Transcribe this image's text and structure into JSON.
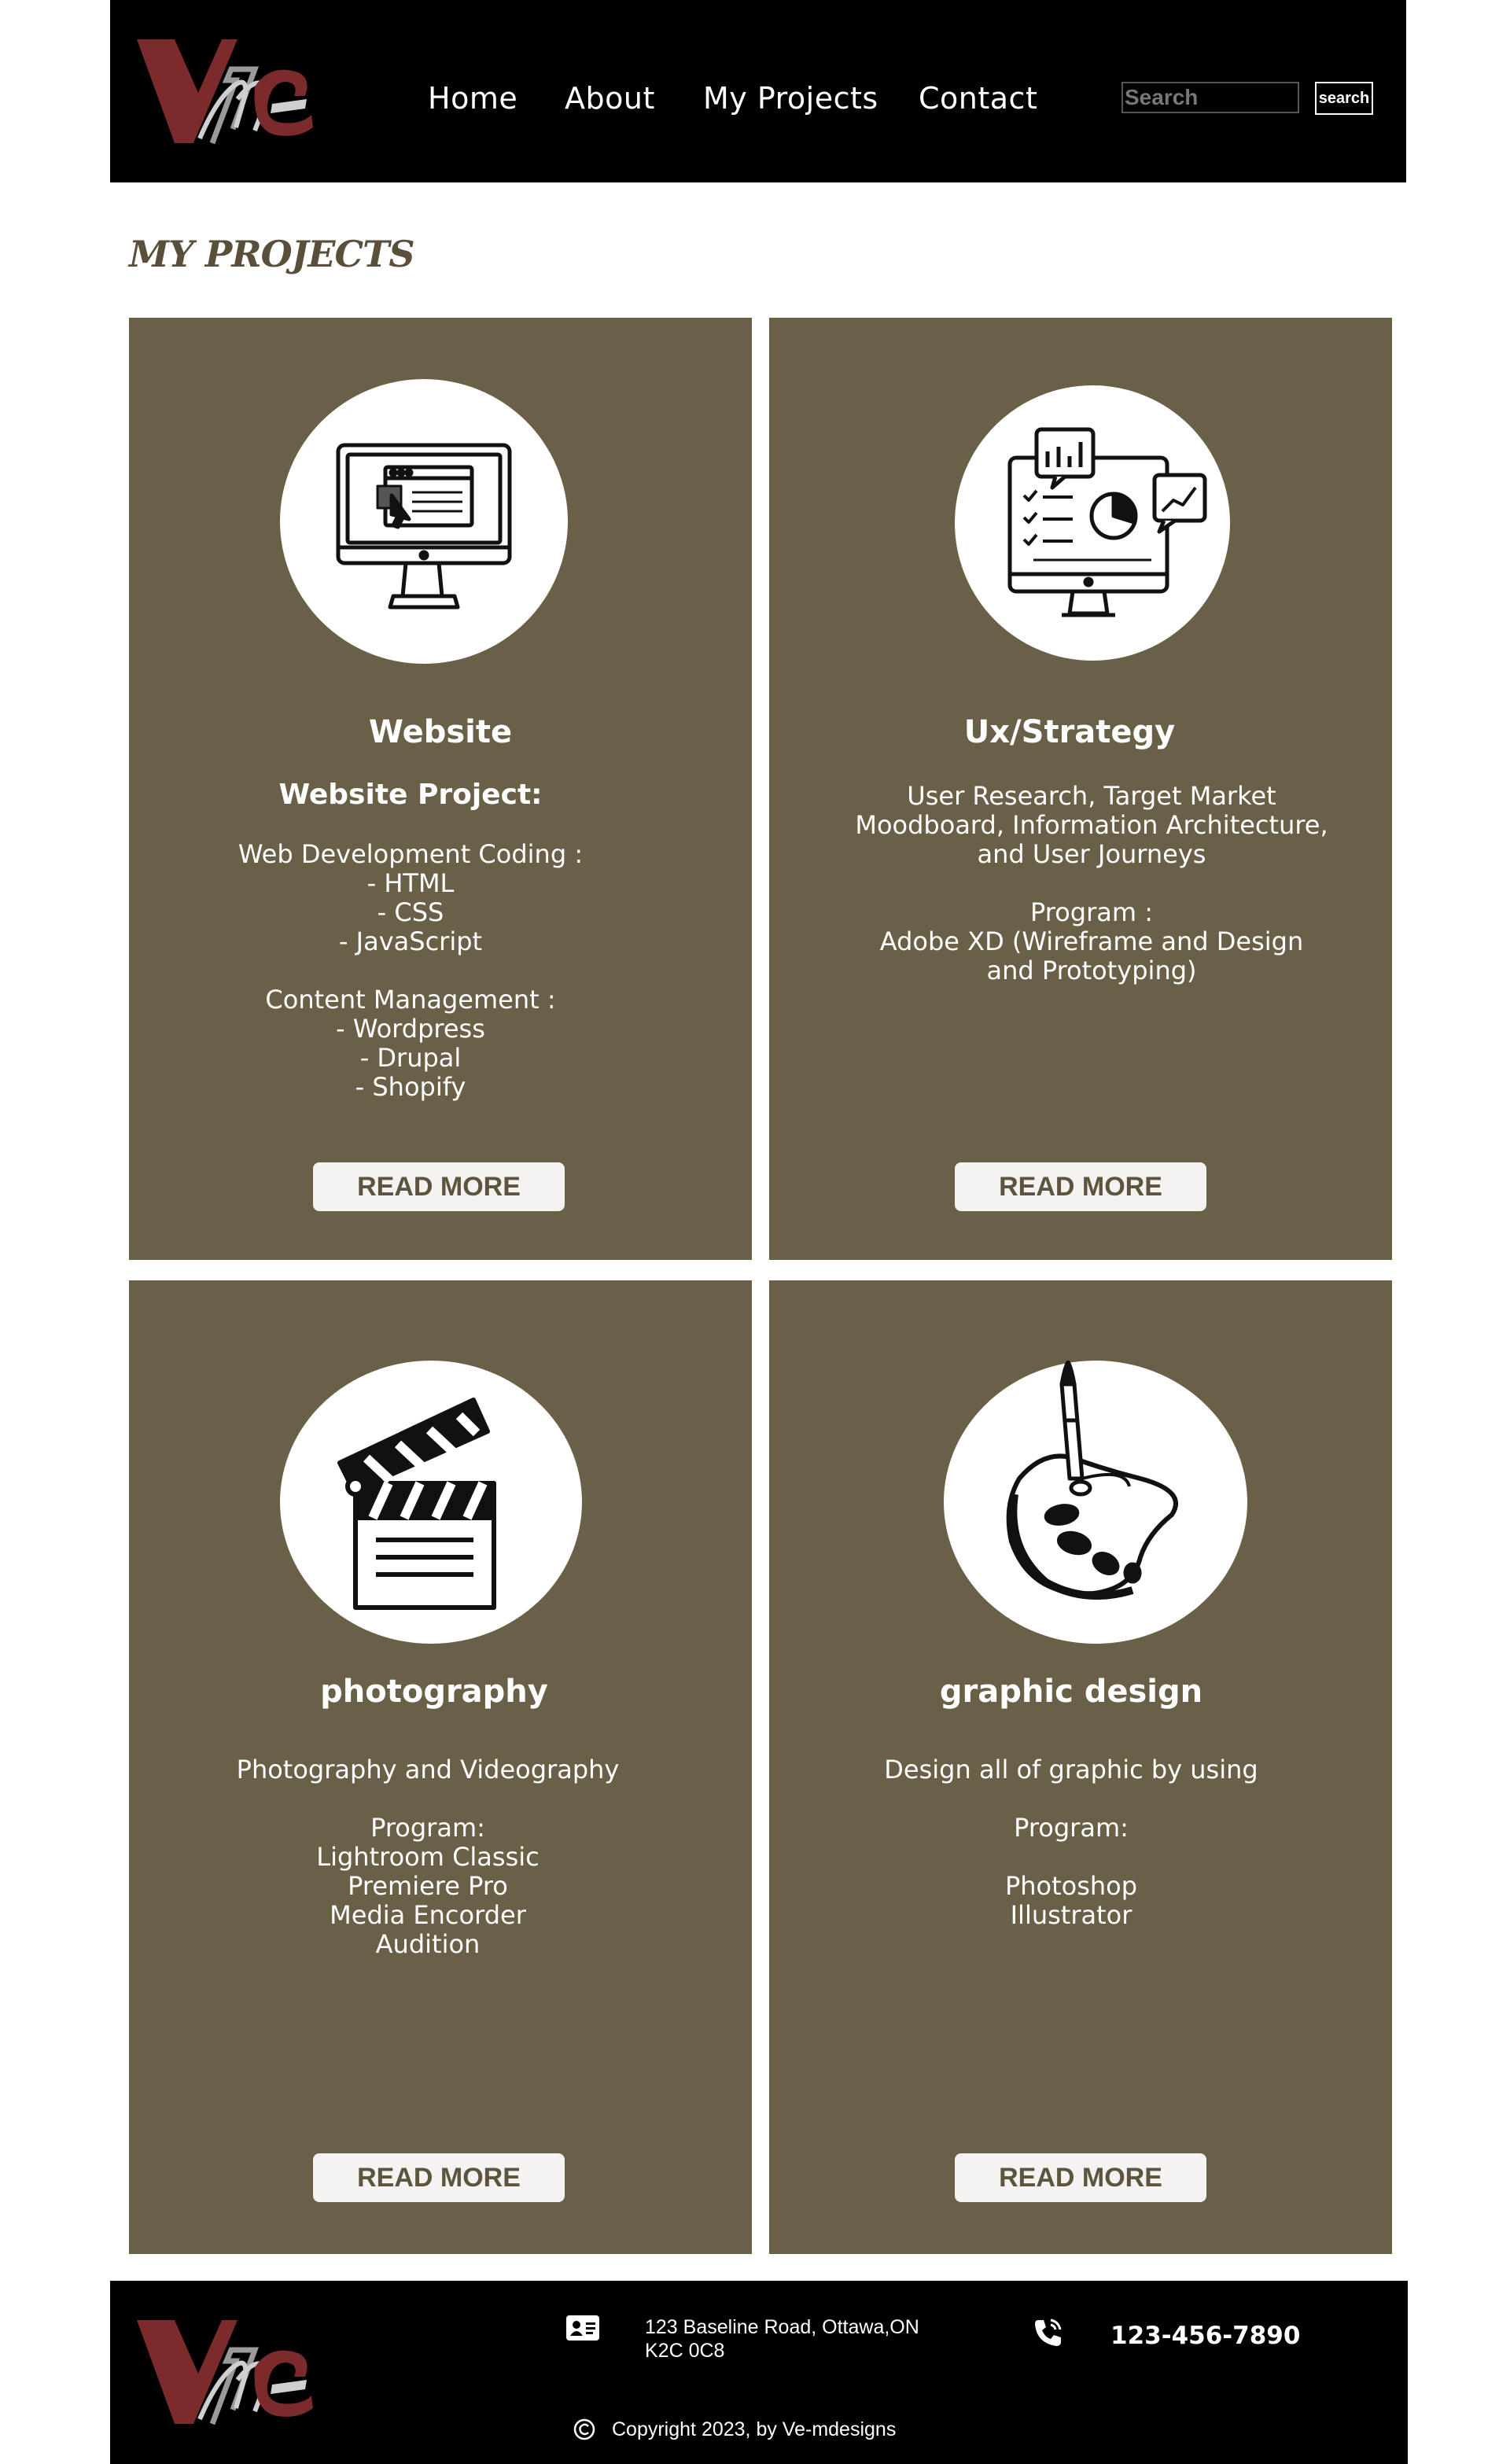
{
  "brand": {
    "logo_text": "Ve-mdesigns",
    "accent_color": "#7b2b2b",
    "panel_color": "#6a5f47"
  },
  "nav": {
    "items": [
      "Home",
      "About",
      "My Projects",
      "Contact"
    ]
  },
  "search": {
    "placeholder": "Search",
    "button_label": "search"
  },
  "page_title": "MY PROJECTS",
  "cards": [
    {
      "icon": "computer-website-icon",
      "title": "Website",
      "subtitle": "Website Project:",
      "lines": [
        "Web Development Coding :",
        "- HTML",
        "- CSS",
        "- JavaScript",
        "",
        "Content Management :",
        "- Wordpress",
        "- Drupal",
        "- Shopify"
      ],
      "button": "READ MORE"
    },
    {
      "icon": "ux-strategy-monitor-icon",
      "title": "Ux/Strategy",
      "lines": [
        "User Research,  Target Market",
        "Moodboard, Information Architecture,",
        "and User Journeys",
        "",
        "Program :",
        "Adobe XD (Wireframe and Design",
        "and Prototyping)"
      ],
      "button": "READ MORE"
    },
    {
      "icon": "clapperboard-icon",
      "title": "photography",
      "lines": [
        "Photography and Videography",
        "",
        "Program:",
        "Lightroom Classic",
        "Premiere Pro",
        "Media Encorder",
        "Audition"
      ],
      "button": "READ MORE"
    },
    {
      "icon": "paint-palette-icon",
      "title": "graphic design",
      "lines": [
        "Design all of graphic by using",
        "",
        "Program:",
        "",
        "Photoshop",
        "Illustrator"
      ],
      "button": "READ MORE"
    }
  ],
  "footer": {
    "address_line1": "123 Baseline Road, Ottawa,ON",
    "address_line2": "K2C 0C8",
    "phone": "123-456-7890",
    "copyright": "Copyright 2023, by Ve-mdesigns",
    "icons": [
      "contact-card-icon",
      "phone-icon",
      "copyright-icon"
    ]
  }
}
